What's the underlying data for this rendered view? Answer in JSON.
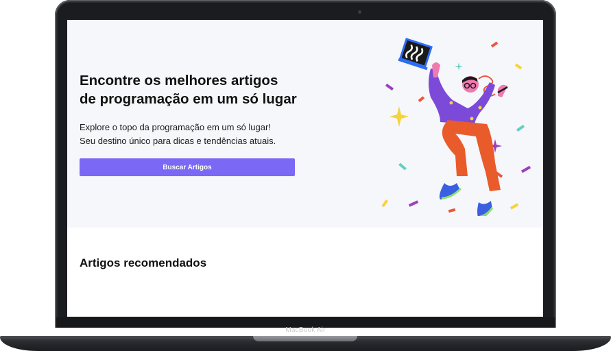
{
  "hero": {
    "title_line1": "Encontre os melhores artigos",
    "title_line2": "de programação em um só lugar",
    "subtitle_line1": "Explore o topo da programação em um só lugar!",
    "subtitle_line2": "Seu destino único para dicas e tendências atuais.",
    "cta_label": "Buscar Artigos"
  },
  "recommended": {
    "title": "Artigos recomendados"
  },
  "device": {
    "label": "MacBook Air"
  },
  "colors": {
    "accent": "#7b68f5",
    "hero_background": "#f6f7fb"
  },
  "illustration": {
    "subject": "developer-celebrating-illustration"
  }
}
